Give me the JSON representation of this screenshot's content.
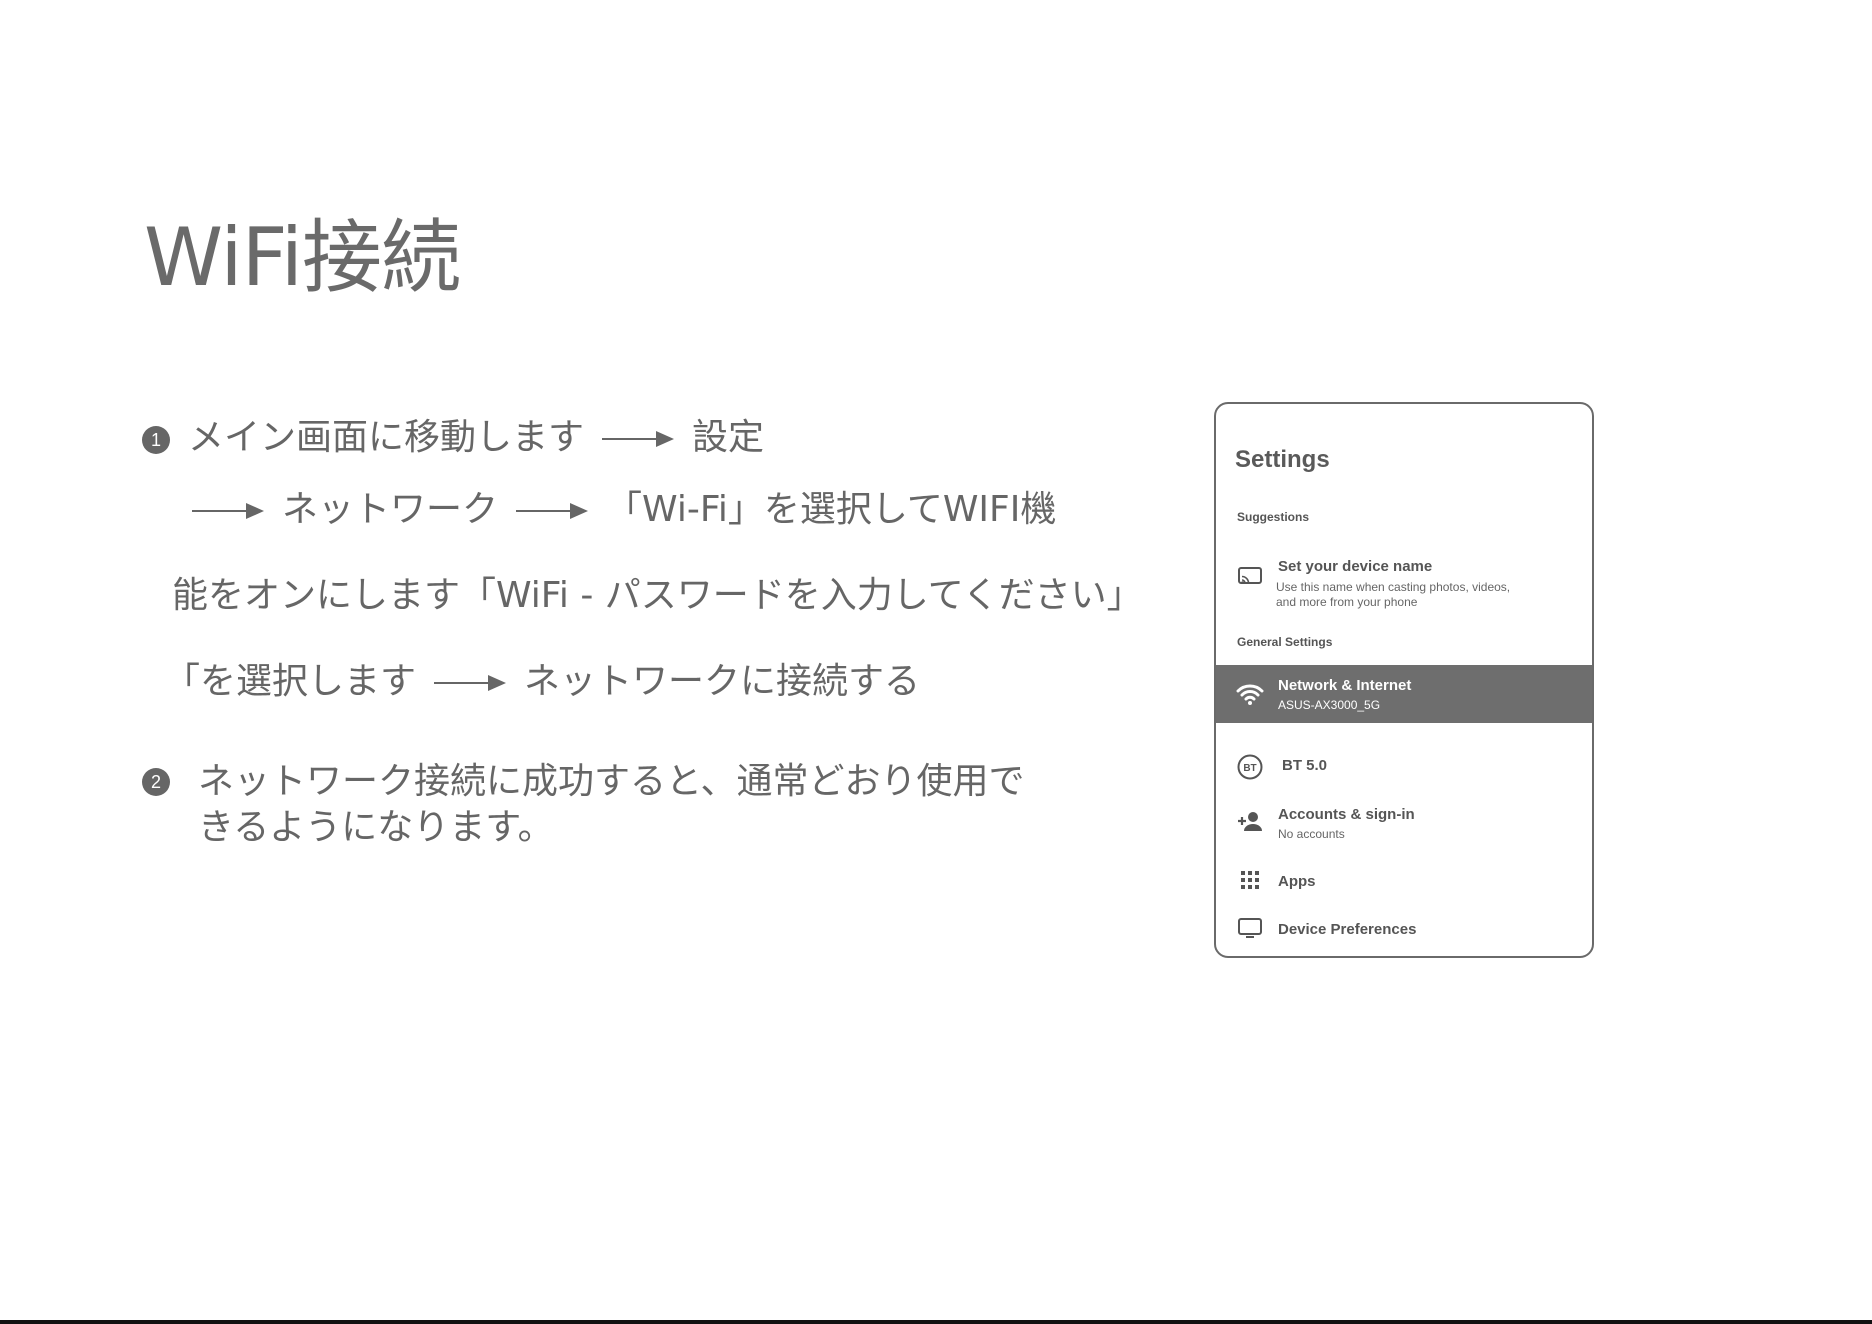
{
  "page_title": "WiFi接続",
  "step1": {
    "number": "1",
    "line1_a": "メイン画面に移動します",
    "line1_b": "設定",
    "line2_a": "ネットワーク",
    "line2_b": "「Wi-Fi」を選択してWIFI機",
    "line3": "能をオンにします「WiFi - パスワードを入力してください」",
    "line4_a": "「を選択します",
    "line4_b": "ネットワークに接続する"
  },
  "step2": {
    "number": "2",
    "line1": "ネットワーク接続に成功すると、通常どおり使用で",
    "line2": "きるようになります。"
  },
  "settings_panel": {
    "title": "Settings",
    "section_suggestions": "Suggestions",
    "suggestion": {
      "label": "Set your device name",
      "desc_line1": "Use this name when casting photos, videos,",
      "desc_line2": "and more from your phone",
      "icon": "cast-icon"
    },
    "section_general": "General Settings",
    "items": [
      {
        "label": "Network & Internet",
        "sub": "ASUS-AX3000_5G",
        "icon": "wifi-icon",
        "active": true
      },
      {
        "label": "BT 5.0",
        "sub": "",
        "icon": "bluetooth-icon",
        "active": false
      },
      {
        "label": "Accounts & sign-in",
        "sub": "No accounts",
        "icon": "add-account-icon",
        "active": false
      },
      {
        "label": "Apps",
        "sub": "",
        "icon": "apps-grid-icon",
        "active": false
      },
      {
        "label": "Device Preferences",
        "sub": "",
        "icon": "tv-icon",
        "active": false
      }
    ],
    "active_color": "#6e6e6e"
  }
}
